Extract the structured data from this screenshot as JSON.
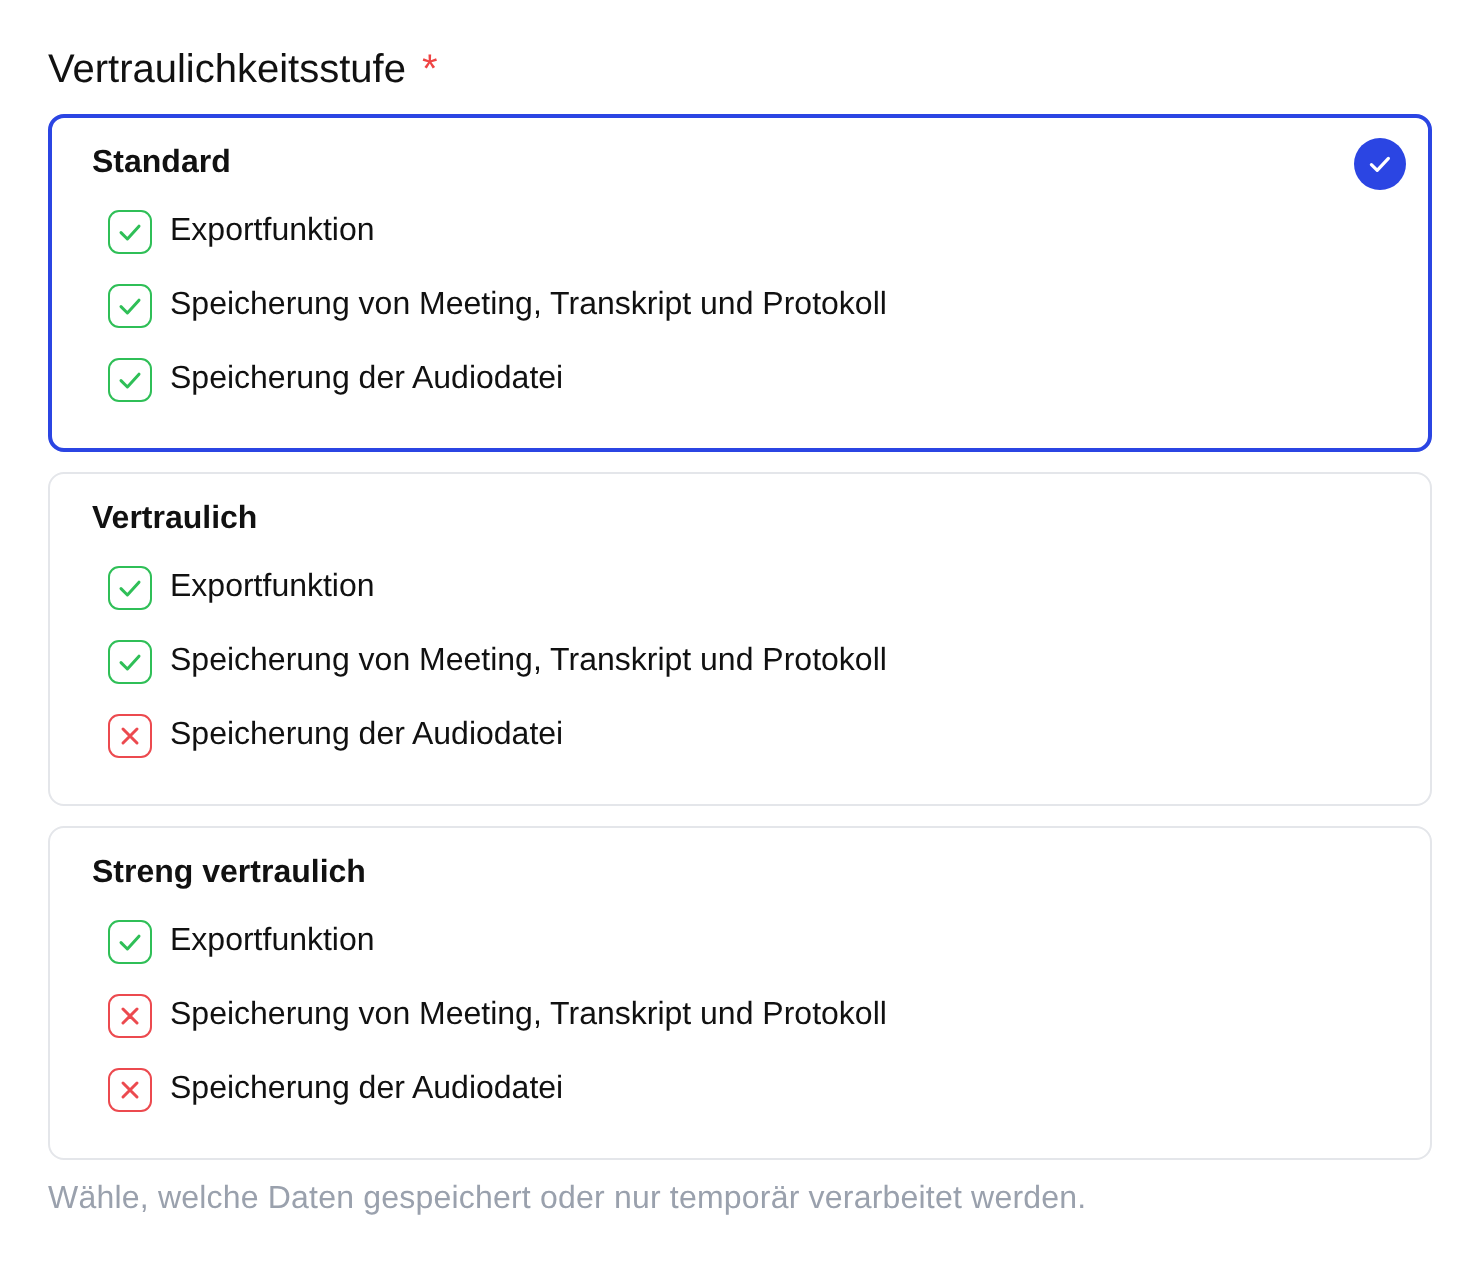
{
  "field": {
    "label": "Vertraulichkeitsstufe",
    "required_mark": "*"
  },
  "levels": [
    {
      "title": "Standard",
      "selected": true,
      "features": [
        {
          "label": "Exportfunktion",
          "included": true
        },
        {
          "label": "Speicherung von Meeting, Transkript und Protokoll",
          "included": true
        },
        {
          "label": "Speicherung der Audiodatei",
          "included": true
        }
      ]
    },
    {
      "title": "Vertraulich",
      "selected": false,
      "features": [
        {
          "label": "Exportfunktion",
          "included": true
        },
        {
          "label": "Speicherung von Meeting, Transkript und Protokoll",
          "included": true
        },
        {
          "label": "Speicherung der Audiodatei",
          "included": false
        }
      ]
    },
    {
      "title": "Streng vertraulich",
      "selected": false,
      "features": [
        {
          "label": "Exportfunktion",
          "included": true
        },
        {
          "label": "Speicherung von Meeting, Transkript und Protokoll",
          "included": false
        },
        {
          "label": "Speicherung der Audiodatei",
          "included": false
        }
      ]
    }
  ],
  "hint": "Wähle, welche Daten gespeichert oder nur temporär verarbeitet werden."
}
